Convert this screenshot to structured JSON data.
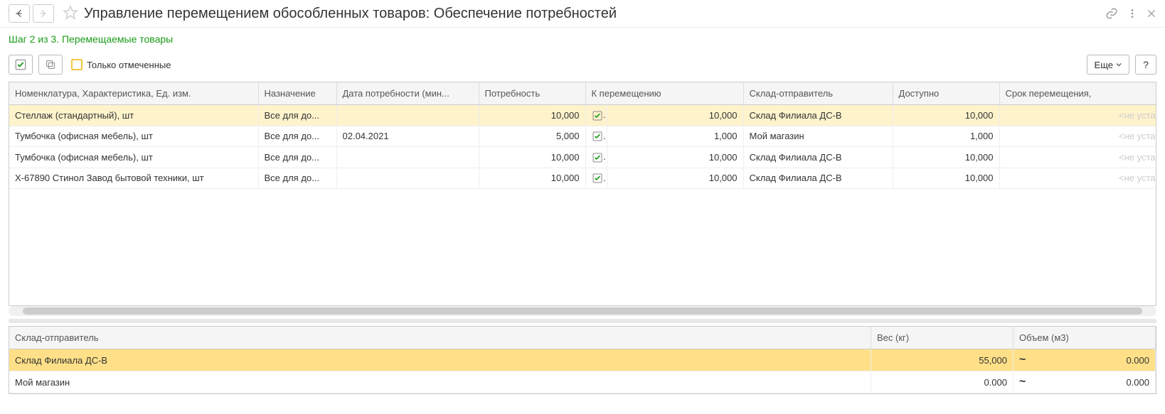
{
  "header": {
    "title": "Управление перемещением обособленных товаров: Обеспечение потребностей"
  },
  "step_label": "Шаг 2 из 3. Перемещаемые товары",
  "toolbar": {
    "only_checked_label": "Только отмеченные",
    "more_label": "Еще",
    "help_label": "?"
  },
  "main_table": {
    "columns": {
      "nomenclature": "Номенклатура, Характеристика, Ед. изм.",
      "assignment": "Назначение",
      "need_date": "Дата потребности (мин...",
      "need": "Потребность",
      "to_move": "К перемещению",
      "sender_warehouse": "Склад-отправитель",
      "available": "Доступно",
      "move_deadline": "Срок перемещения,"
    },
    "rows": [
      {
        "nomenclature": "Стеллаж (стандартный), шт",
        "assignment": "Все для до...",
        "need_date": "",
        "need": "10,000",
        "checked": true,
        "to_move": "10,000",
        "sender_warehouse": "Склад Филиала ДС-В",
        "available": "10,000",
        "deadline": "<не уста",
        "highlighted": true
      },
      {
        "nomenclature": "Тумбочка (офисная мебель), шт",
        "assignment": "Все для до...",
        "need_date": "02.04.2021",
        "need": "5,000",
        "checked": true,
        "to_move": "1,000",
        "sender_warehouse": "Мой магазин",
        "available": "1,000",
        "deadline": "<не уста",
        "highlighted": false
      },
      {
        "nomenclature": "Тумбочка (офисная мебель), шт",
        "assignment": "Все для до...",
        "need_date": "",
        "need": "10,000",
        "checked": true,
        "to_move": "10,000",
        "sender_warehouse": "Склад Филиала ДС-В",
        "available": "10,000",
        "deadline": "<не уста",
        "highlighted": false
      },
      {
        "nomenclature": "Х-67890 Стинол Завод бытовой техники, шт",
        "assignment": "Все для до...",
        "need_date": "",
        "need": "10,000",
        "checked": true,
        "to_move": "10,000",
        "sender_warehouse": "Склад Филиала ДС-В",
        "available": "10,000",
        "deadline": "<не уста",
        "highlighted": false
      }
    ]
  },
  "bottom_table": {
    "columns": {
      "sender_warehouse": "Склад-отправитель",
      "weight": "Вес (кг)",
      "volume": "Объем (м3)"
    },
    "rows": [
      {
        "warehouse": "Склад Филиала ДС-В",
        "weight": "55,000",
        "volume": "0.000",
        "highlighted": true
      },
      {
        "warehouse": "Мой магазин",
        "weight": "0.000",
        "volume": "0.000",
        "highlighted": false
      }
    ]
  }
}
